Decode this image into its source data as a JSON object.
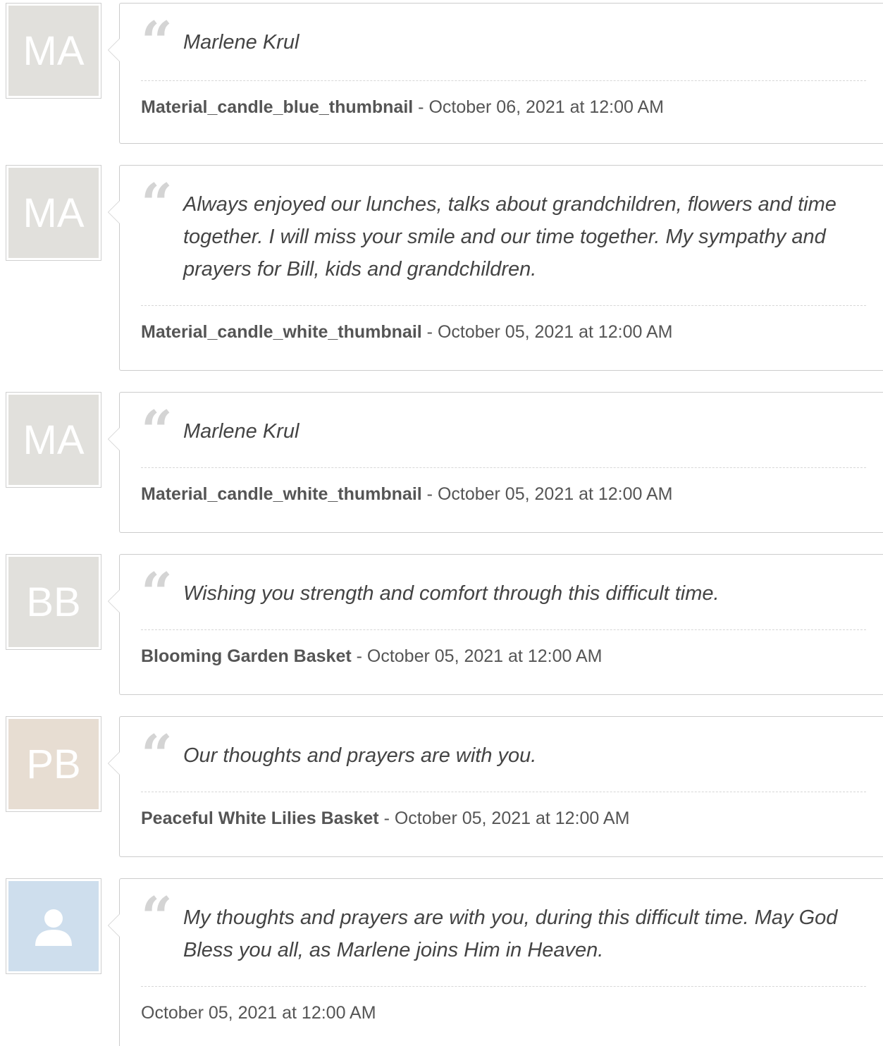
{
  "entries": [
    {
      "avatar_initials": "MA",
      "avatar_icon": "",
      "message": "Marlene Krul",
      "item": "Material_candle_blue_thumbnail",
      "separator": " - ",
      "date": "October 06, 2021 at 12:00 AM"
    },
    {
      "avatar_initials": "MA",
      "avatar_icon": "",
      "message": "Always enjoyed our lunches, talks about grandchildren, flowers and time together. I will miss your smile and our time together. My sympathy and prayers for Bill, kids and grandchildren.",
      "item": "Material_candle_white_thumbnail",
      "separator": " - ",
      "date": "October 05, 2021 at 12:00 AM"
    },
    {
      "avatar_initials": "MA",
      "avatar_icon": "",
      "message": "Marlene Krul",
      "item": "Material_candle_white_thumbnail",
      "separator": " - ",
      "date": "October 05, 2021 at 12:00 AM"
    },
    {
      "avatar_initials": "BB",
      "avatar_icon": "",
      "message": "Wishing you strength and comfort through this difficult time.",
      "item": "Blooming Garden Basket",
      "separator": " - ",
      "date": "October 05, 2021 at 12:00 AM"
    },
    {
      "avatar_initials": "PB",
      "avatar_icon": "",
      "message": "Our thoughts and prayers are with you.",
      "item": "Peaceful White Lilies Basket",
      "separator": " - ",
      "date": "October 05, 2021 at 12:00 AM"
    },
    {
      "avatar_initials": "",
      "avatar_icon": "user-silhouette-icon",
      "message": "My thoughts and prayers are with you, during this difficult time. May God Bless you all, as Marlene joins Him in Heaven.",
      "item": "",
      "separator": "",
      "date": "October 05, 2021 at 12:00 AM"
    }
  ],
  "quote_glyph": "“",
  "colors": {
    "avatar_gray": "#e1e0dc",
    "avatar_tan": "#e7ddd2",
    "avatar_blue": "#cedeed",
    "card_border": "#cccccc",
    "quote_mark": "#d4d4d4",
    "text": "#444444"
  }
}
